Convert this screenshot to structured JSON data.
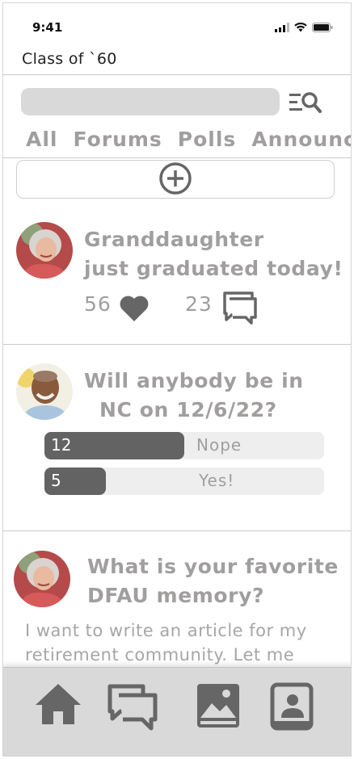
{
  "status_bar": {
    "time": "9:41"
  },
  "header": {
    "title": "Class of `60"
  },
  "search": {
    "placeholder": ""
  },
  "tabs": [
    {
      "label": "All"
    },
    {
      "label": "Forums"
    },
    {
      "label": "Polls"
    },
    {
      "label": "Announcements"
    }
  ],
  "posts": {
    "first": {
      "title_line1": "Granddaughter",
      "title_line2": "just graduated today!",
      "likes": "56",
      "comments": "23"
    },
    "poll": {
      "title_line1": "Will anybody be in",
      "title_line2": "NC on 12/6/22?",
      "options": [
        {
          "count": "12",
          "label": "Nope",
          "fraction": 0.5
        },
        {
          "count": "5",
          "label": "Yes!",
          "fraction": 0.22
        }
      ]
    },
    "third": {
      "title_line1": "What is your favorite",
      "title_line2": "DFAU memory?",
      "body": "I want to write an article for my retirement community. Let me"
    }
  },
  "colors": {
    "text_muted": "#a19e9e",
    "poll_fill": "#636363",
    "poll_track": "#eeeeee",
    "nav_bg": "#d9d9d9",
    "icon": "#666666"
  }
}
